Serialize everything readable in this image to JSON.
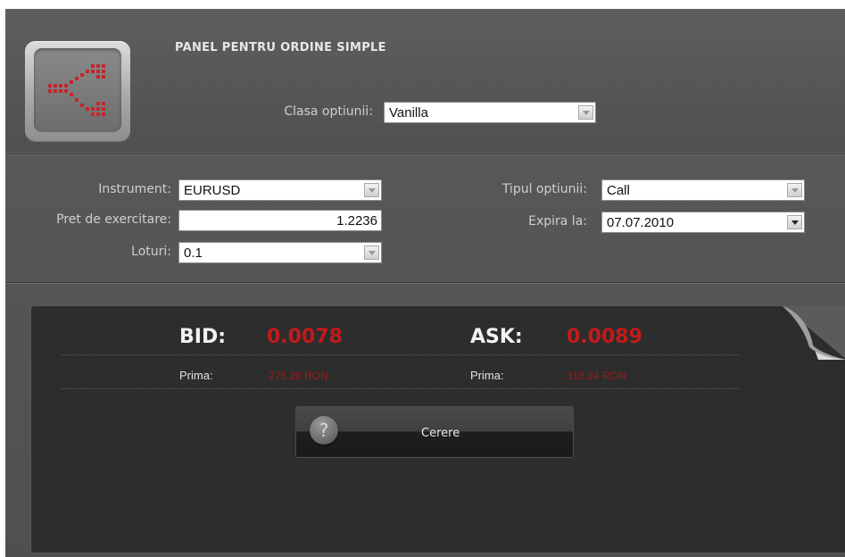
{
  "panel": {
    "title": "PANEL PENTRU ORDINE SIMPLE",
    "logo_icon": "split-arrows-icon"
  },
  "option_class": {
    "label": "Clasa optiunii:",
    "value": "Vanilla"
  },
  "form": {
    "instrument": {
      "label": "Instrument:",
      "value": "EURUSD"
    },
    "strike": {
      "label": "Pret de exercitare:",
      "value": "1.2236"
    },
    "lots": {
      "label": "Loturi:",
      "value": "0.1"
    },
    "option_type": {
      "label": "Tipul optiunii:",
      "value": "Call"
    },
    "expiry": {
      "label": "Expira la:",
      "value": "07.07.2010"
    }
  },
  "quote": {
    "bid_label": "BID:",
    "bid_value": "0.0078",
    "ask_label": "ASK:",
    "ask_value": "0.0089",
    "bid_premium_label": "Prima:",
    "bid_premium_value": "276.20 RON",
    "ask_premium_label": "Prima:",
    "ask_premium_value": "316.24 RON"
  },
  "request_button": {
    "label": "Cerere",
    "icon": "question-icon"
  },
  "colors": {
    "accent_red": "#c21a1a",
    "panel_bg": "#2d2d2d",
    "frame_bg": "#555555"
  }
}
